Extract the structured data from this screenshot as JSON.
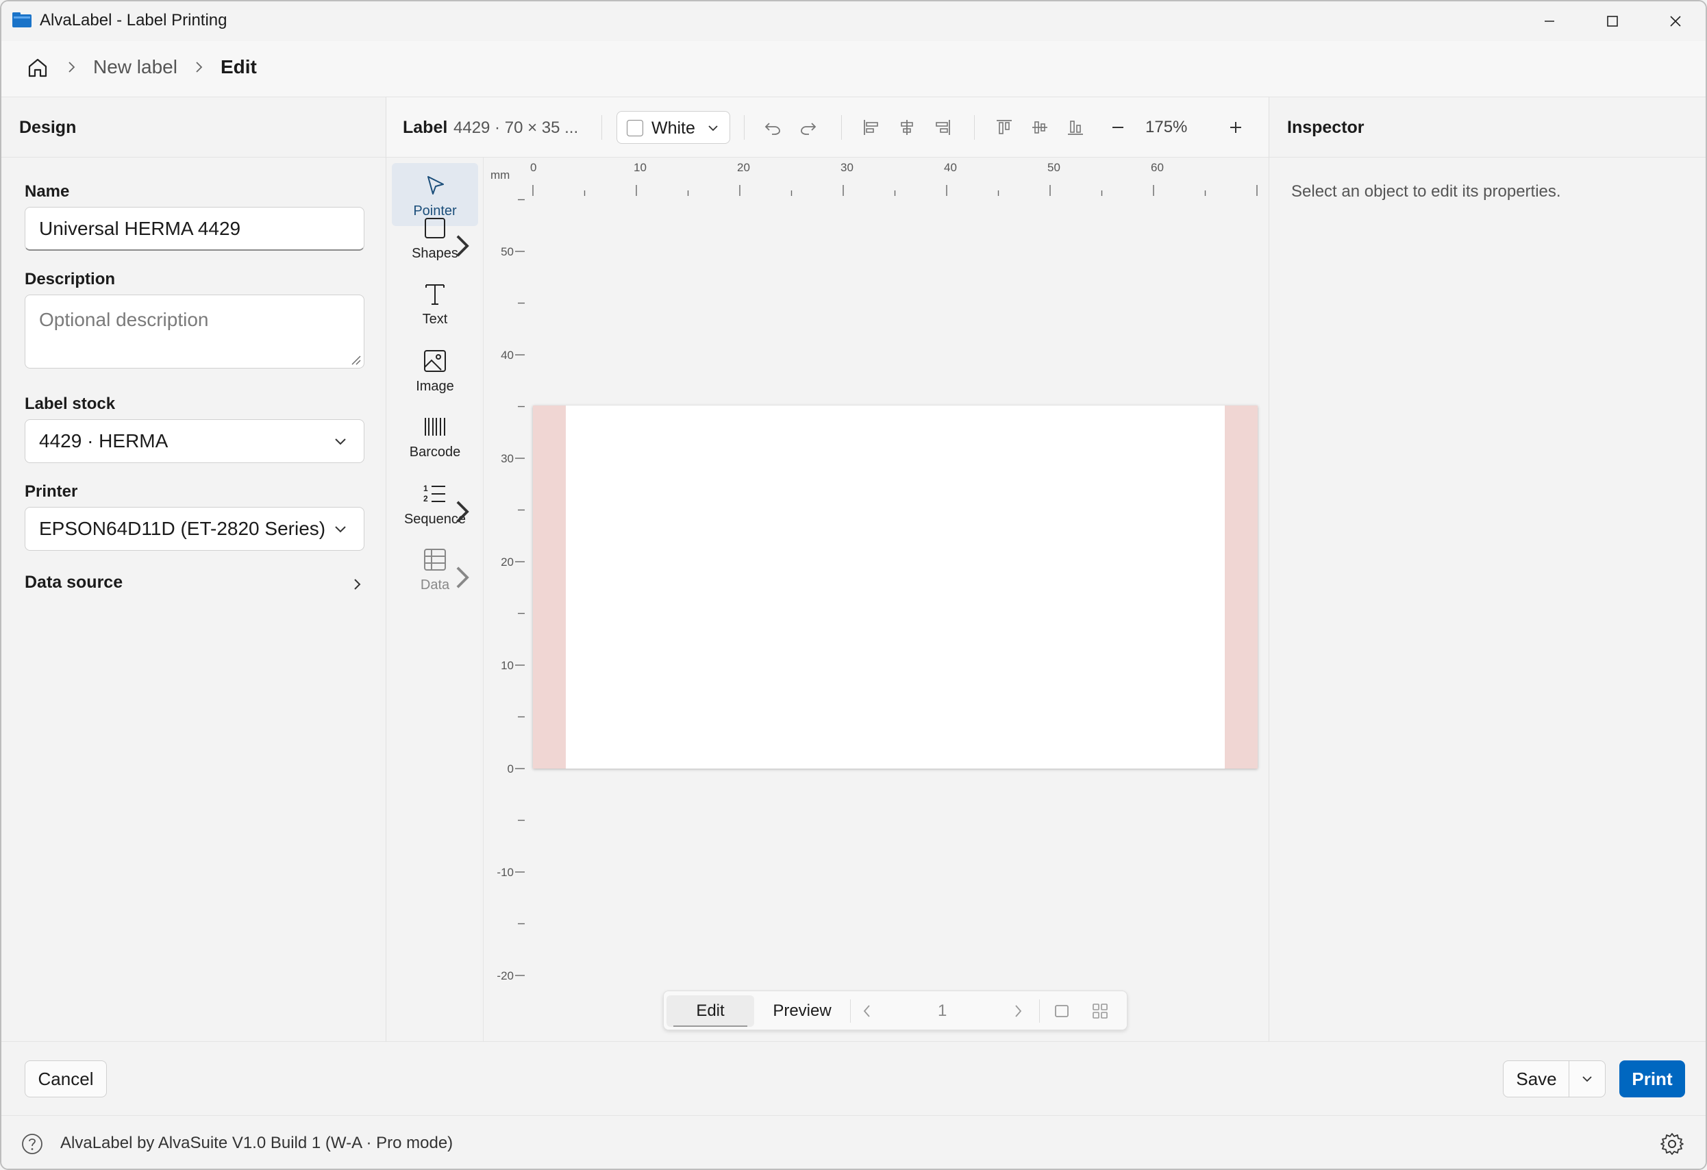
{
  "window": {
    "title": "AlvaLabel - Label Printing"
  },
  "breadcrumb": {
    "items": [
      "New label",
      "Edit"
    ]
  },
  "design": {
    "heading": "Design",
    "name_label": "Name",
    "name_value": "Universal HERMA 4429",
    "description_label": "Description",
    "description_placeholder": "Optional description",
    "stock_label": "Label stock",
    "stock_value": "4429 · HERMA",
    "printer_label": "Printer",
    "printer_value": "EPSON64D11D (ET-2820 Series)",
    "data_source_label": "Data source"
  },
  "toolbar": {
    "label_heading": "Label",
    "label_info": "4429 · 70 × 35 ...",
    "background_color_label": "White",
    "zoom": "175%"
  },
  "tools": [
    {
      "label": "Pointer",
      "icon": "pointer-icon"
    },
    {
      "label": "Shapes",
      "icon": "square-icon"
    },
    {
      "label": "Text",
      "icon": "text-icon"
    },
    {
      "label": "Image",
      "icon": "image-icon"
    },
    {
      "label": "Barcode",
      "icon": "barcode-icon"
    },
    {
      "label": "Sequence",
      "icon": "numbered-list-icon"
    },
    {
      "label": "Data",
      "icon": "table-icon"
    }
  ],
  "ruler": {
    "unit": "mm",
    "x_labels": [
      "0",
      "10",
      "20",
      "30",
      "40",
      "50",
      "60"
    ],
    "y_labels": [
      "50",
      "40",
      "30",
      "20",
      "10",
      "0",
      "-10",
      "-20"
    ]
  },
  "bottombar": {
    "edit": "Edit",
    "preview": "Preview",
    "page": "1"
  },
  "inspector": {
    "heading": "Inspector",
    "hint": "Select an object to edit its properties."
  },
  "footer": {
    "cancel": "Cancel",
    "save": "Save",
    "print": "Print"
  },
  "status": {
    "text": "AlvaLabel by AlvaSuite V1.0 Build 1 (W-A · Pro mode)"
  },
  "colors": {
    "accent": "#0067c0",
    "bleed": "#f0d6d3",
    "active_tool": "#e2e8f0"
  }
}
